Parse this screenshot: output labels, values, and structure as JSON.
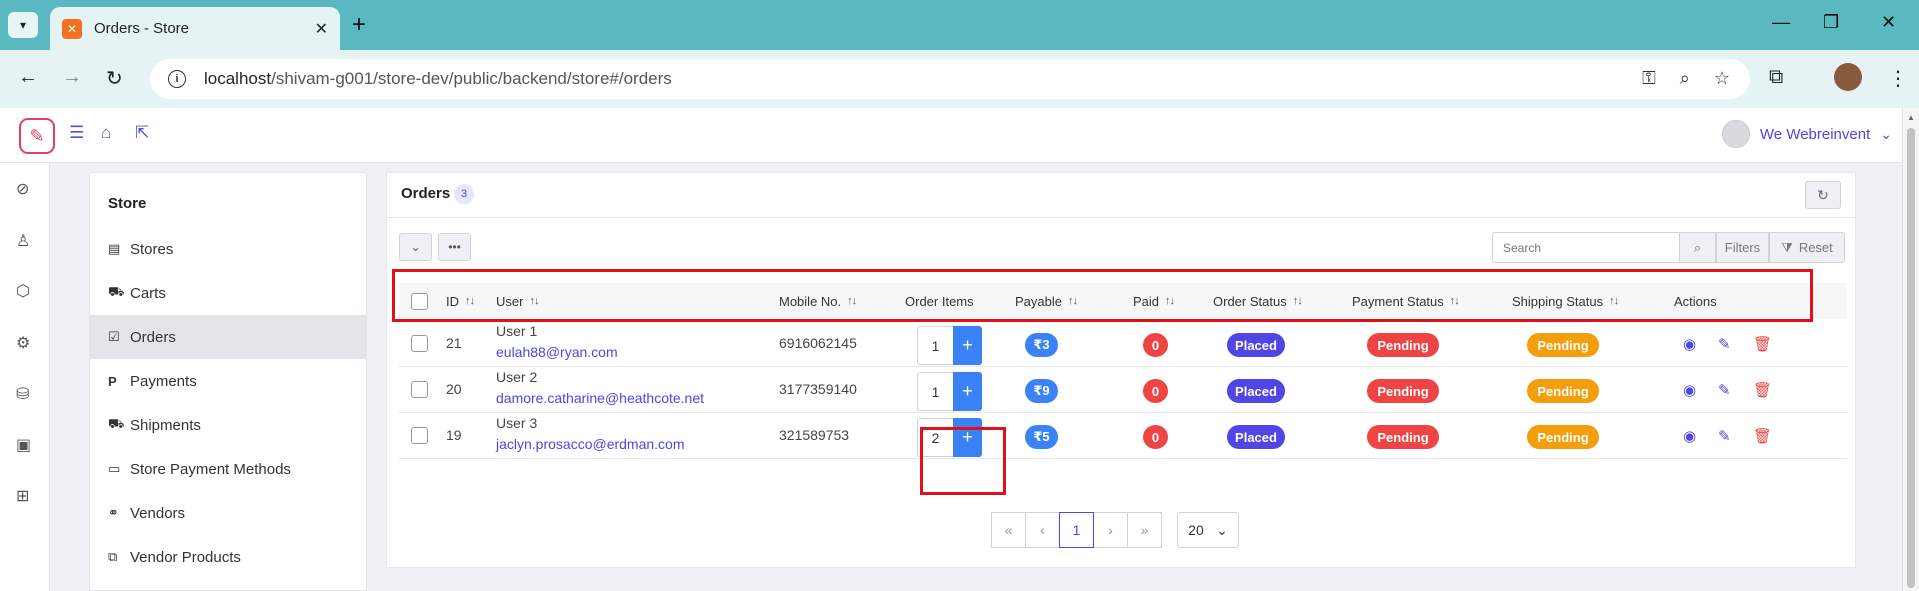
{
  "browser": {
    "tab_title": "Orders - Store",
    "tab_favicon_letter": "✕",
    "url_host": "localhost",
    "url_path": "/shivam-g001/store-dev/public/backend/store#/orders"
  },
  "header": {
    "user_name": "We Webreinvent"
  },
  "store_menu": {
    "title": "Store",
    "items": [
      {
        "label": "Stores",
        "icon": "building-icon"
      },
      {
        "label": "Carts",
        "icon": "cart-icon"
      },
      {
        "label": "Orders",
        "icon": "check-square-icon",
        "active": true
      },
      {
        "label": "Payments",
        "icon": "paypal-icon"
      },
      {
        "label": "Shipments",
        "icon": "truck-icon"
      },
      {
        "label": "Store Payment Methods",
        "icon": "credit-card-icon"
      },
      {
        "label": "Vendors",
        "icon": "handshake-icon"
      },
      {
        "label": "Vendor Products",
        "icon": "copy-icon"
      }
    ]
  },
  "orders": {
    "title": "Orders",
    "count": "3",
    "search_placeholder": "Search",
    "filters_label": "Filters",
    "reset_label": "Reset",
    "columns": [
      "ID",
      "User",
      "Mobile No.",
      "Order Items",
      "Payable",
      "Paid",
      "Order Status",
      "Payment Status",
      "Shipping Status",
      "Actions"
    ],
    "rows": [
      {
        "id": "21",
        "user": "User 1",
        "email": "eulah88@ryan.com",
        "mobile": "6916062145",
        "items": "1",
        "payable": "₹3",
        "paid": "0",
        "order_status": "Placed",
        "payment_status": "Pending",
        "shipping_status": "Pending"
      },
      {
        "id": "20",
        "user": "User 2",
        "email": "damore.catharine@heathcote.net",
        "mobile": "3177359140",
        "items": "1",
        "payable": "₹9",
        "paid": "0",
        "order_status": "Placed",
        "payment_status": "Pending",
        "shipping_status": "Pending"
      },
      {
        "id": "19",
        "user": "User 3",
        "email": "jaclyn.prosacco@erdman.com",
        "mobile": "321589753",
        "items": "2",
        "payable": "₹5",
        "paid": "0",
        "order_status": "Placed",
        "payment_status": "Pending",
        "shipping_status": "Pending"
      }
    ],
    "pagination": {
      "current_page": "1",
      "per_page": "20"
    }
  },
  "colors": {
    "accent": "#4f46e5",
    "primary_blue": "#3b82f6",
    "danger": "#ef4444",
    "warning": "#f59e0b",
    "highlight": "#e3101c",
    "chrome": "#5ab8c1"
  }
}
